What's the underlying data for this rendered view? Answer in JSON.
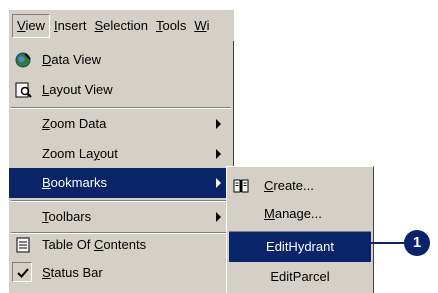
{
  "menubar": {
    "items": [
      {
        "pre": "",
        "u": "V",
        "post": "iew"
      },
      {
        "pre": "",
        "u": "I",
        "post": "nsert"
      },
      {
        "pre": "",
        "u": "S",
        "post": "election"
      },
      {
        "pre": "",
        "u": "T",
        "post": "ools"
      },
      {
        "pre": "",
        "u": "W",
        "post": "i"
      }
    ]
  },
  "view_menu": {
    "data_view": {
      "pre": "",
      "u": "D",
      "post": "ata View",
      "icon": "data-view-icon"
    },
    "layout_view": {
      "pre": "",
      "u": "L",
      "post": "ayout View",
      "icon": "layout-view-icon"
    },
    "zoom_data": {
      "pre": "",
      "u": "Z",
      "post": "oom Data"
    },
    "zoom_layout": {
      "pre": "Zoom La",
      "u": "y",
      "post": "out"
    },
    "bookmarks": {
      "pre": "",
      "u": "B",
      "post": "ookmarks"
    },
    "toolbars": {
      "pre": "",
      "u": "T",
      "post": "oolbars"
    },
    "toc": {
      "pre": "Table Of ",
      "u": "C",
      "post": "ontents",
      "icon": "table-of-contents-icon"
    },
    "status_bar": {
      "pre": "",
      "u": "S",
      "post": "tatus Bar",
      "icon": "checkmark-icon"
    }
  },
  "bookmarks_menu": {
    "create": {
      "pre": "",
      "u": "C",
      "post": "reate...",
      "icon": "create-bookmark-icon"
    },
    "manage": {
      "pre": "",
      "u": "M",
      "post": "anage..."
    },
    "bookmarks": [
      "EditHydrant",
      "EditParcel"
    ]
  },
  "callout": {
    "number": "1"
  },
  "colors": {
    "highlight": "#0a246a",
    "menu_bg": "#d4d0c8"
  }
}
